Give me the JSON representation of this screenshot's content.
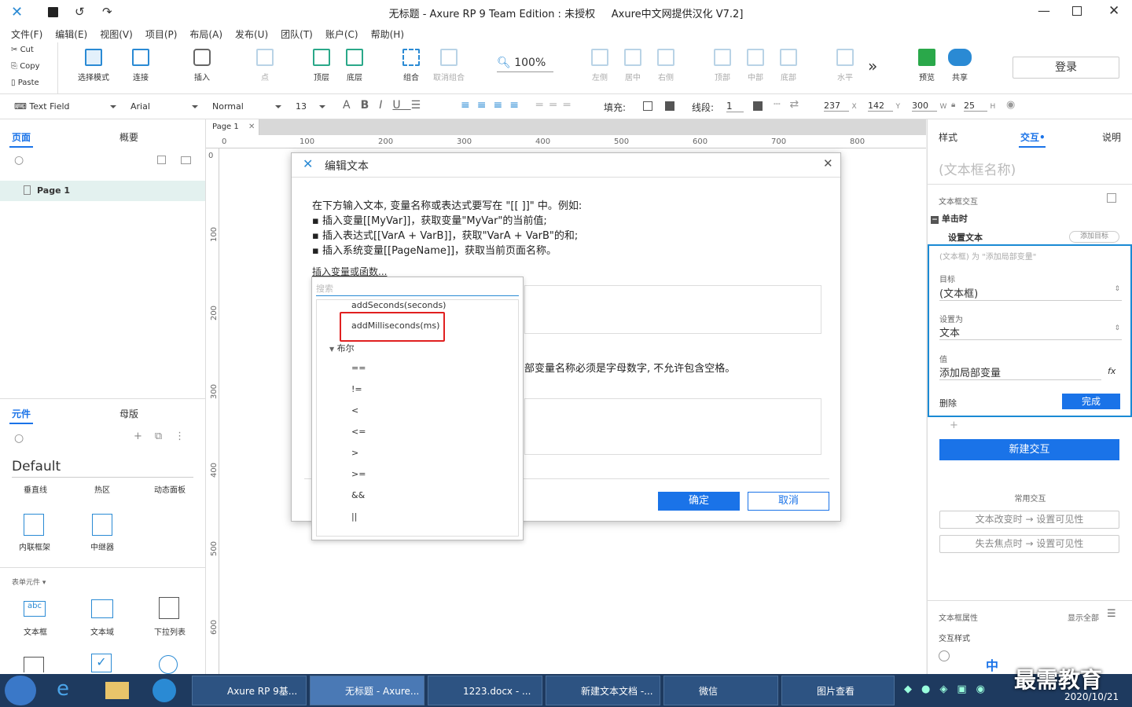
{
  "window": {
    "title": "无标题 - Axure RP 9 Team Edition : 未授权",
    "subtitle": "Axure中文网提供汉化 V7.2]"
  },
  "menu": [
    "文件(F)",
    "编辑(E)",
    "视图(V)",
    "项目(P)",
    "布局(A)",
    "发布(U)",
    "团队(T)",
    "账户(C)",
    "帮助(H)"
  ],
  "clipboard": {
    "cut": "Cut",
    "copy": "Copy",
    "paste": "Paste"
  },
  "toolbar": {
    "select": "选择模式",
    "connect": "连接",
    "insert": "插入",
    "point": "点",
    "top": "顶层",
    "bottom": "底层",
    "group": "组合",
    "ungroup": "取消组合",
    "zoom": "100%",
    "left": "左侧",
    "center": "居中",
    "right": "右侧",
    "vtop": "顶部",
    "middle": "中部",
    "vbottom": "底部",
    "horizontal": "水平",
    "more": "»",
    "preview": "预览",
    "share": "共享",
    "login": "登录"
  },
  "format": {
    "widget": "Text Field",
    "font": "Arial",
    "style": "Normal",
    "size": "13",
    "fill_label": "填充:",
    "line_label": "线段:",
    "line_val": "1",
    "x": "237",
    "x_lbl": "X",
    "y": "142",
    "y_lbl": "Y",
    "w": "300",
    "w_lbl": "W",
    "h": "25",
    "h_lbl": "H"
  },
  "left": {
    "tab_pages": "页面",
    "tab_outline": "概要",
    "page_item": "Page 1",
    "tab_widgets": "元件",
    "tab_masters": "母版",
    "library": "Default",
    "row1": [
      "垂直线",
      "热区",
      "动态面板"
    ],
    "row2": [
      "内联框架",
      "中继器"
    ],
    "section": "表单元件 ▾",
    "row3": [
      "文本框",
      "文本域",
      "下拉列表"
    ]
  },
  "canvas": {
    "tab": "Page 1",
    "ruler": [
      "0",
      "100",
      "200",
      "300",
      "400",
      "500",
      "600",
      "700",
      "800"
    ],
    "vruler": [
      "0",
      "100",
      "200",
      "300",
      "400",
      "500",
      "600"
    ]
  },
  "dialog": {
    "title": "编辑文本",
    "intro": "在下方输入文本, 变量名称或表达式要写在 \"[[ ]]\" 中。例如:",
    "b1": "▪ 插入变量[[MyVar]]，获取变量\"MyVar\"的当前值;",
    "b2": "▪ 插入表达式[[VarA + VarB]]，获取\"VarA + VarB\"的和;",
    "b3": "▪ 插入系统变量[[PageName]]，获取当前页面名称。",
    "insert_link": "插入变量或函数...",
    "partial": "部变量名称必须是字母数字, 不允许包含空格。",
    "ok": "确定",
    "cancel": "取消"
  },
  "dropdown": {
    "search_placeholder": "搜索",
    "items": [
      "addSeconds(seconds)",
      "addMilliseconds(ms)"
    ],
    "category": "布尔",
    "ops": [
      "==",
      "!=",
      "<",
      "<=",
      ">",
      ">=",
      "&&",
      "||"
    ]
  },
  "right": {
    "tab_style": "样式",
    "tab_interact": "交互",
    "tab_notes": "说明",
    "name_placeholder": "(文本框名称)",
    "section": "文本框交互",
    "event": "单击时",
    "action": "设置文本",
    "add_target": "添加目标",
    "summary": "(文本框) 为 \"添加局部变量\"",
    "target_lbl": "目标",
    "target_val": "(文本框)",
    "setas_lbl": "设置为",
    "setas_val": "文本",
    "value_lbl": "值",
    "value_val": "添加局部变量",
    "fx": "fx",
    "delete": "删除",
    "done": "完成",
    "plus": "+",
    "new_interaction": "新建交互",
    "common": "常用交互",
    "common1": "文本改变时 → 设置可见性",
    "common2": "失去焦点时 → 设置可见性",
    "props": "文本框属性",
    "show_all": "显示全部",
    "interact_style": "交互样式"
  },
  "taskbar": {
    "tasks": [
      "Axure RP 9基...",
      "无标题 - Axure...",
      "1223.docx - ...",
      "新建文本文档 -...",
      "微信",
      "图片查看"
    ],
    "date": "2020/10/21",
    "ime": "中",
    "watermark": "最需教育"
  },
  "colors": {
    "accent": "#1a73e8",
    "highlight": "#e02020"
  }
}
